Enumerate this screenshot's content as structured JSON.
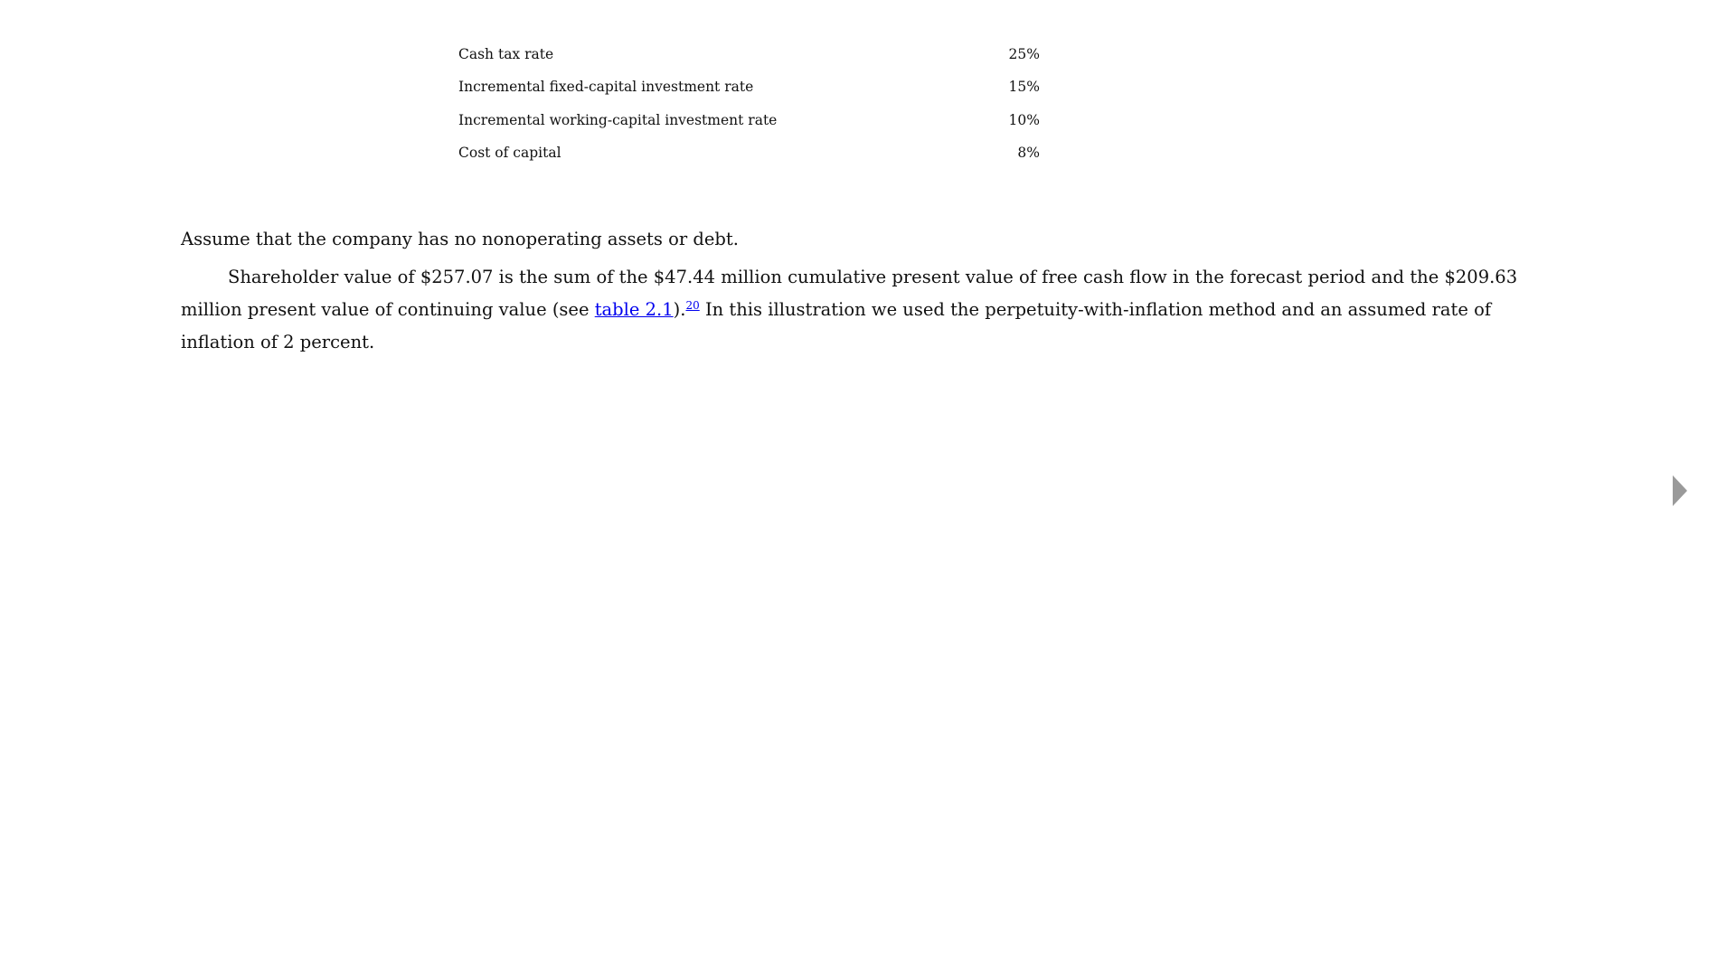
{
  "table": {
    "rows": [
      {
        "label": "Cash tax rate",
        "value": "25%"
      },
      {
        "label": "Incremental fixed-capital investment rate",
        "value": "15%"
      },
      {
        "label": "Incremental working-capital investment rate",
        "value": "10%"
      },
      {
        "label": "Cost of capital",
        "value": "8%"
      }
    ]
  },
  "body": {
    "p1": "Assume that the company has no nonoperating assets or debt.",
    "p2_part1": "Shareholder value of $257.07 is the sum of the $47.44 million cumulative present value of free cash flow in the forecast period and the $209.63 million present value of continuing value (see ",
    "p2_link": "table 2.1",
    "p2_part2": ").",
    "p2_footnote": "20",
    "p2_part3": " In this illustration we used the perpetuity-with-inflation method and an assumed rate of inflation of 2 percent."
  },
  "navigation": {
    "next_icon": "triangle-right",
    "next_color": "#9a9a9a"
  },
  "colors": {
    "link": "#0000ee",
    "text": "#111111",
    "background": "#ffffff"
  }
}
